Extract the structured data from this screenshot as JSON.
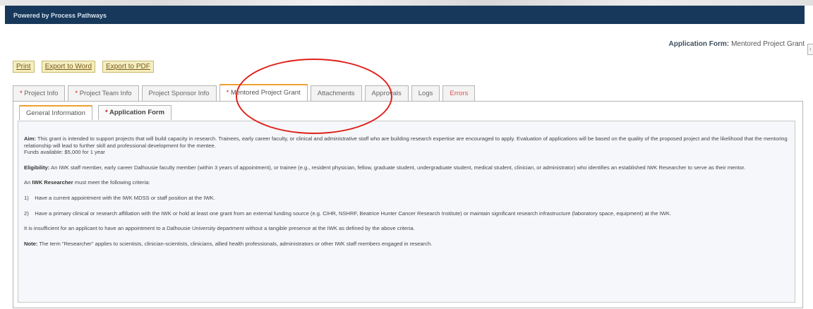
{
  "header": {
    "banner_text": "Powered by Process Pathways",
    "application_form_label": "Application Form:",
    "application_form_value": "Mentored Project Grant"
  },
  "actions": {
    "print": "Print",
    "export_word": "Export to Word",
    "export_pdf": "Export to PDF"
  },
  "tabs": [
    {
      "req": "*",
      "label": "Project Info"
    },
    {
      "req": "*",
      "label": "Project Team Info"
    },
    {
      "req": "",
      "label": "Project Sponsor Info"
    },
    {
      "req": "*",
      "label": "Mentored Project Grant"
    },
    {
      "req": "",
      "label": "Attachments"
    },
    {
      "req": "",
      "label": "Approvals"
    },
    {
      "req": "",
      "label": "Logs"
    },
    {
      "req": "",
      "label": "Errors"
    }
  ],
  "subtabs": {
    "general": "General Information",
    "application_req": "*",
    "application": "Application Form"
  },
  "content": {
    "aim_label": "Aim:",
    "aim_text": "This grant is intended to support projects that will build capacity in research. Trainees, early career faculty, or clinical and administrative staff who are building research expertise are encouraged to apply. Evaluation of applications will be based on the quality of the proposed project and the likelihood that the mentoring relationship will lead to further skill and professional development for the mentee.",
    "funds": "Funds available: $5,000 for 1 year",
    "eligibility_label": "Eligibility:",
    "eligibility_text": "An IWK staff member, early career Dalhousie faculty member (within 3 years of appointment), or trainee (e.g., resident physician, fellow, graduate student, undergraduate student, medical student, clinician, or administrator) who identifies an established IWK Researcher to serve as their mentor.",
    "criteria_pre": "An",
    "criteria_bold": "IWK Researcher",
    "criteria_post": "must meet the following criteria:",
    "item1_num": "1)",
    "item1_text": "Have a current appointment with the IWK MDSS or staff position at the IWK.",
    "item2_num": "2)",
    "item2_text": "Have a primary clinical or research affiliation with the IWK or hold at least one grant from an external funding source (e.g. CIHR, NSHRF, Beatrice Hunter Cancer Research Institute) or maintain significant research infrastructure (laboratory space, equipment) at the IWK.",
    "insufficient": "It is insufficient for an applicant to have an appointment to a Dalhousie University department without a tangible presence at the IWK as defined by the above criteria.",
    "note_label": "Note:",
    "note_text": "The term \"Researcher\" applies to scientists, clinician-scientists, clinicians, allied health professionals, administrators or other IWK staff members engaged in research."
  },
  "colors": {
    "banner": "#17385a",
    "active_tab_accent": "#f0a030",
    "annotation": "#e0211b",
    "button_bg": "#f4eec1"
  }
}
